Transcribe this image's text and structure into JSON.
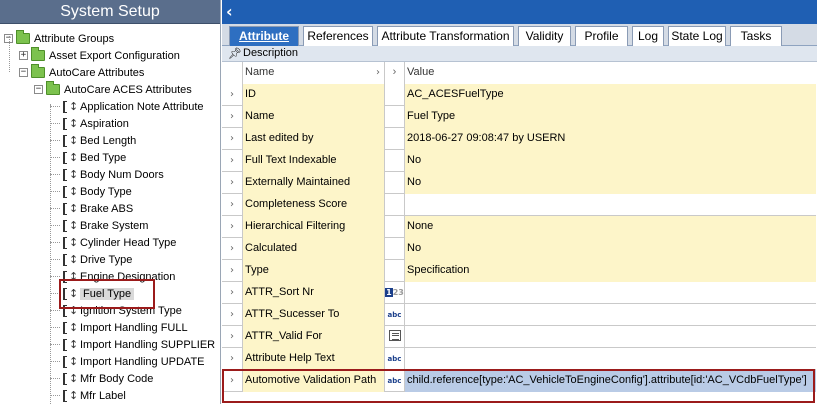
{
  "left_panel": {
    "title": "System Setup",
    "tree": [
      {
        "label": "Attribute Groups",
        "type": "folder",
        "expander": "−"
      },
      {
        "label": "Asset Export Configuration",
        "type": "folder",
        "expander": "+"
      },
      {
        "label": "AutoCare Attributes",
        "type": "folder",
        "expander": "−"
      },
      {
        "label": "AutoCare ACES Attributes",
        "type": "folder",
        "expander": "−"
      },
      {
        "label": "Application Note Attribute",
        "type": "attribute"
      },
      {
        "label": "Aspiration",
        "type": "attribute"
      },
      {
        "label": "Bed Length",
        "type": "attribute"
      },
      {
        "label": "Bed Type",
        "type": "attribute"
      },
      {
        "label": "Body Num Doors",
        "type": "attribute"
      },
      {
        "label": "Body Type",
        "type": "attribute"
      },
      {
        "label": "Brake ABS",
        "type": "attribute"
      },
      {
        "label": "Brake System",
        "type": "attribute"
      },
      {
        "label": "Cylinder Head Type",
        "type": "attribute"
      },
      {
        "label": "Drive Type",
        "type": "attribute"
      },
      {
        "label": "Engine Designation",
        "type": "attribute"
      },
      {
        "label": "Fuel Type",
        "type": "attribute",
        "selected": true
      },
      {
        "label": "Ignition System Type",
        "type": "attribute"
      },
      {
        "label": "Import Handling FULL",
        "type": "attribute"
      },
      {
        "label": "Import Handling SUPPLIER",
        "type": "attribute"
      },
      {
        "label": "Import Handling UPDATE",
        "type": "attribute"
      },
      {
        "label": "Mfr Body Code",
        "type": "attribute"
      },
      {
        "label": "Mfr Label",
        "type": "attribute"
      }
    ]
  },
  "right_panel": {
    "back_icon": "chevron-left-icon",
    "tabs": [
      "Attribute",
      "References",
      "Attribute Transformation",
      "Validity",
      "Profile",
      "Log",
      "State Log",
      "Tasks"
    ],
    "active_tab": "Attribute",
    "description_label": "Description",
    "grid": {
      "header": {
        "name": "Name",
        "value": "Value"
      },
      "rows": [
        {
          "name": "ID",
          "value": "AC_ACESFuelType",
          "icon": ""
        },
        {
          "name": "Name",
          "value": "Fuel Type",
          "icon": ""
        },
        {
          "name": "Last edited by",
          "value": "2018-06-27 09:08:47 by USERN",
          "icon": ""
        },
        {
          "name": "Full Text Indexable",
          "value": "No",
          "icon": ""
        },
        {
          "name": "Externally Maintained",
          "value": "No",
          "icon": ""
        },
        {
          "name": "Completeness Score",
          "value": "",
          "icon": ""
        },
        {
          "name": "Hierarchical Filtering",
          "value": "None",
          "icon": ""
        },
        {
          "name": "Calculated",
          "value": "No",
          "icon": ""
        },
        {
          "name": "Type",
          "value": "Specification",
          "icon": ""
        },
        {
          "name": "ATTR_Sort Nr",
          "value": "",
          "icon": "number-icon"
        },
        {
          "name": "ATTR_Sucesser To",
          "value": "",
          "icon": "text-abc-icon"
        },
        {
          "name": "ATTR_Valid For",
          "value": "",
          "icon": "list-icon"
        },
        {
          "name": "Attribute Help Text",
          "value": "",
          "icon": "text-abc-icon"
        },
        {
          "name": "Automotive Validation Path",
          "value": "child.reference[type:'AC_VehicleToEngineConfig'].attribute[id:'AC_VCdbFuelType']",
          "icon": "text-abc-icon",
          "selected": true
        }
      ]
    },
    "icon_text": {
      "abc": "abc",
      "num_a": "1",
      "num_b": "23"
    }
  },
  "colors": {
    "title_bar": "#5a6e8c",
    "top_bar": "#1f5fb3",
    "active_tab": "#2e6fc1",
    "row_highlight": "#fdf5c9",
    "selection": "#b9cbe6",
    "callout_border": "#9b1b1b"
  }
}
